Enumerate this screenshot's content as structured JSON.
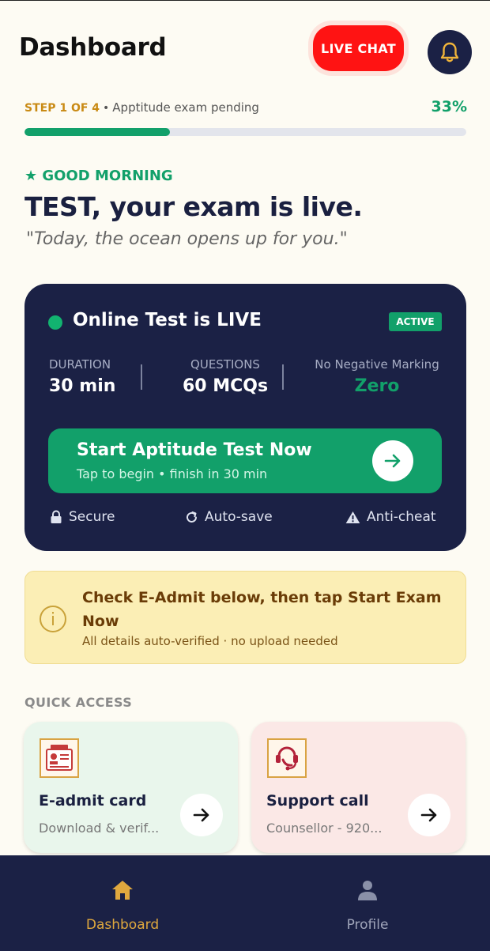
{
  "header": {
    "title": "Dashboard",
    "live_chat_label": "LIVE CHAT"
  },
  "progress": {
    "step_label": "STEP 1 OF 4",
    "separator": "•",
    "status": "Apptitude exam pending",
    "percent_label": "33%",
    "percent": 33
  },
  "greeting": {
    "label": "★ GOOD MORNING",
    "headline": "TEST, your exam is live.",
    "quote": "\"Today, the ocean opens up for you.\""
  },
  "live_card": {
    "title": "Online Test is LIVE",
    "badge": "ACTIVE",
    "stats": [
      {
        "label": "DURATION",
        "value": "30 min"
      },
      {
        "label": "QUESTIONS",
        "value": "60 MCQs"
      },
      {
        "label": "No Negative Marking",
        "value": "Zero"
      }
    ],
    "start_button": {
      "title": "Start Aptitude Test Now",
      "subtitle": "Tap to begin • finish in 30 min"
    },
    "features": [
      {
        "label": "Secure",
        "icon": "lock-icon"
      },
      {
        "label": "Auto-save",
        "icon": "refresh-icon"
      },
      {
        "label": "Anti-cheat",
        "icon": "warning-icon"
      }
    ]
  },
  "notice": {
    "title": "Check E-Admit below, then tap Start Exam Now",
    "subtitle": "All details auto-verified · no upload needed"
  },
  "quick_access": {
    "label": "QUICK ACCESS",
    "items": [
      {
        "title": "E-admit card",
        "subtitle": "Download & verif...",
        "icon": "id-card-icon"
      },
      {
        "title": "Support call",
        "subtitle": "Counsellor - 920...",
        "icon": "phone-call-icon"
      }
    ]
  },
  "bottom_nav": {
    "items": [
      {
        "label": "Dashboard",
        "icon": "home-icon",
        "active": true
      },
      {
        "label": "Profile",
        "icon": "person-icon",
        "active": false
      }
    ]
  },
  "colors": {
    "navy": "#1b2145",
    "green": "#12a06a",
    "live_red": "#ff1313",
    "gold": "#c98a14",
    "background": "#fdfbf3"
  }
}
